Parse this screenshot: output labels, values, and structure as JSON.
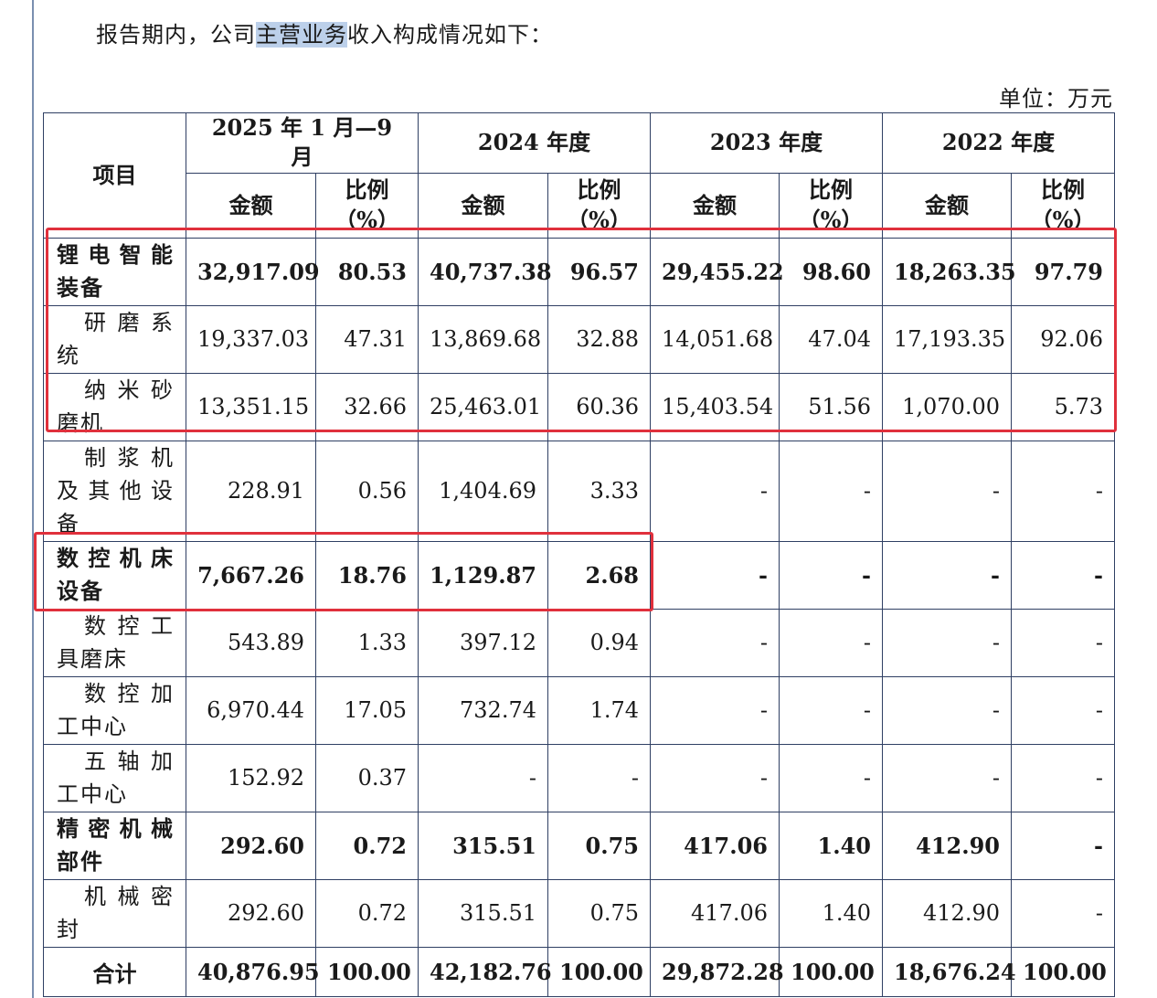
{
  "intro": {
    "before": "报告期内，公司",
    "highlight": "主营业务",
    "after": "收入构成情况如下："
  },
  "unit": "单位：万元",
  "table": {
    "item_header": "项目",
    "periods": [
      "2025 年 1 月—9 月",
      "2024 年度",
      "2023 年度",
      "2022 年度"
    ],
    "amount_label": "金额",
    "ratio_label": "比例（%）",
    "rows": [
      {
        "name": "锂电智能装备",
        "bold": true,
        "cells": [
          "32,917.09",
          "80.53",
          "40,737.38",
          "96.57",
          "29,455.22",
          "98.60",
          "18,263.35",
          "97.79"
        ]
      },
      {
        "name": "研磨系统",
        "bold": false,
        "cells": [
          "19,337.03",
          "47.31",
          "13,869.68",
          "32.88",
          "14,051.68",
          "47.04",
          "17,193.35",
          "92.06"
        ]
      },
      {
        "name": "纳米砂磨机",
        "bold": false,
        "cells": [
          "13,351.15",
          "32.66",
          "25,463.01",
          "60.36",
          "15,403.54",
          "51.56",
          "1,070.00",
          "5.73"
        ]
      },
      {
        "name": "制浆机及其他设备",
        "bold": false,
        "cells": [
          "228.91",
          "0.56",
          "1,404.69",
          "3.33",
          "-",
          "-",
          "-",
          "-"
        ]
      },
      {
        "name": "数控机床设备",
        "bold": true,
        "cells": [
          "7,667.26",
          "18.76",
          "1,129.87",
          "2.68",
          "-",
          "-",
          "-",
          "-"
        ]
      },
      {
        "name": "数控工具磨床",
        "bold": false,
        "cells": [
          "543.89",
          "1.33",
          "397.12",
          "0.94",
          "-",
          "-",
          "-",
          "-"
        ]
      },
      {
        "name": "数控加工中心",
        "bold": false,
        "cells": [
          "6,970.44",
          "17.05",
          "732.74",
          "1.74",
          "-",
          "-",
          "-",
          "-"
        ]
      },
      {
        "name": "五轴加工中心",
        "bold": false,
        "cells": [
          "152.92",
          "0.37",
          "-",
          "-",
          "-",
          "-",
          "-",
          "-"
        ]
      },
      {
        "name": "精密机械部件",
        "bold": true,
        "cells": [
          "292.60",
          "0.72",
          "315.51",
          "0.75",
          "417.06",
          "1.40",
          "412.90",
          "-"
        ]
      },
      {
        "name": "机械密封",
        "bold": false,
        "cells": [
          "292.60",
          "0.72",
          "315.51",
          "0.75",
          "417.06",
          "1.40",
          "412.90",
          "-"
        ]
      }
    ],
    "total": {
      "name": "合计",
      "cells": [
        "40,876.95",
        "100.00",
        "42,182.76",
        "100.00",
        "29,872.28",
        "100.00",
        "18,676.24",
        "100.00"
      ]
    }
  },
  "colors": {
    "highlight_box": "#e0303c",
    "text_highlight": "#bcd0ea",
    "border": "#2f3f63"
  }
}
